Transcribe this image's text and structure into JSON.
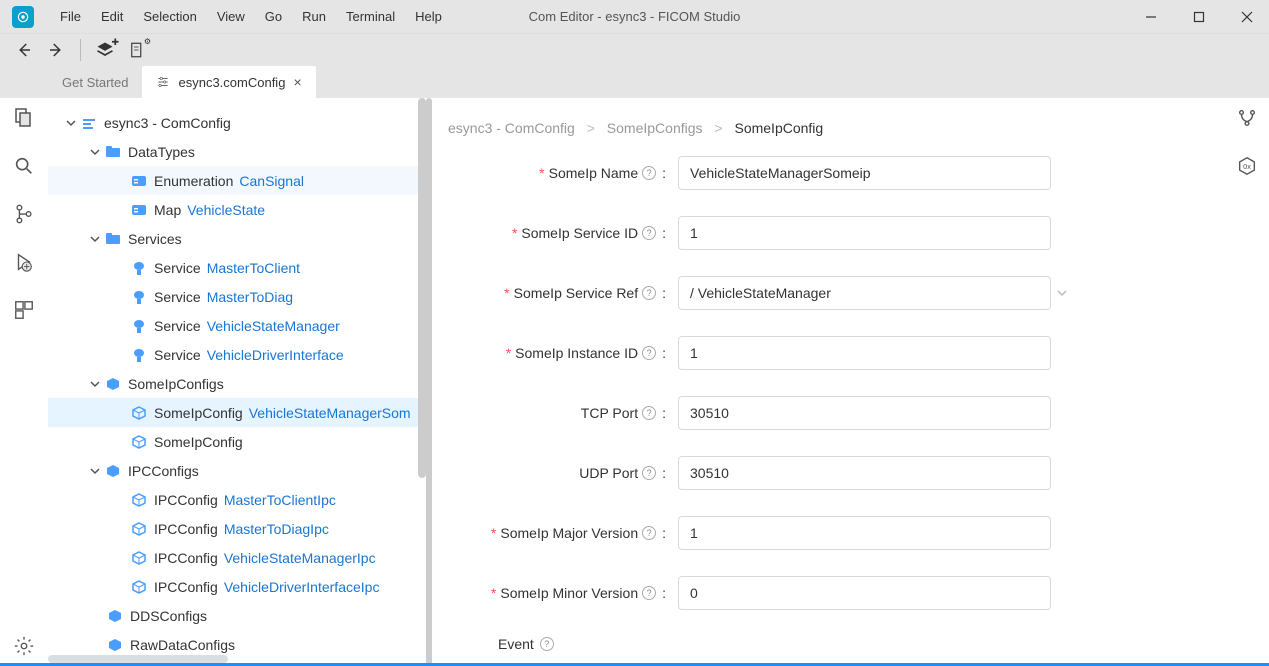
{
  "window": {
    "title": "Com Editor - esync3 - FICOM Studio"
  },
  "menu": [
    "File",
    "Edit",
    "Selection",
    "View",
    "Go",
    "Run",
    "Terminal",
    "Help"
  ],
  "tabs": [
    {
      "label": "Get Started",
      "active": false
    },
    {
      "label": "esync3.comConfig",
      "active": true
    }
  ],
  "tree": {
    "root": {
      "label": "esync3 - ComConfig"
    },
    "dataTypes": {
      "label": "DataTypes",
      "items": [
        {
          "type": "Enumeration",
          "name": "CanSignal"
        },
        {
          "type": "Map",
          "name": "VehicleState"
        }
      ]
    },
    "services": {
      "label": "Services",
      "items": [
        {
          "type": "Service",
          "name": "MasterToClient"
        },
        {
          "type": "Service",
          "name": "MasterToDiag"
        },
        {
          "type": "Service",
          "name": "VehicleStateManager"
        },
        {
          "type": "Service",
          "name": "VehicleDriverInterface"
        }
      ]
    },
    "someIpConfigs": {
      "label": "SomeIpConfigs",
      "items": [
        {
          "type": "SomeIpConfig",
          "name": "VehicleStateManagerSom",
          "selected": true
        },
        {
          "type": "SomeIpConfig",
          "name": ""
        }
      ]
    },
    "ipcConfigs": {
      "label": "IPCConfigs",
      "items": [
        {
          "type": "IPCConfig",
          "name": "MasterToClientIpc"
        },
        {
          "type": "IPCConfig",
          "name": "MasterToDiagIpc"
        },
        {
          "type": "IPCConfig",
          "name": "VehicleStateManagerIpc"
        },
        {
          "type": "IPCConfig",
          "name": "VehicleDriverInterfaceIpc"
        }
      ]
    },
    "ddsConfigs": {
      "label": "DDSConfigs"
    },
    "rawDataConfigs": {
      "label": "RawDataConfigs"
    }
  },
  "breadcrumb": {
    "items": [
      "esync3 - ComConfig",
      "SomeIpConfigs"
    ],
    "current": "SomeIpConfig"
  },
  "form": {
    "someIpName": {
      "label": "SomeIp Name",
      "value": "VehicleStateManagerSomeip",
      "required": true
    },
    "serviceId": {
      "label": "SomeIp Service ID",
      "value": "1",
      "required": true
    },
    "serviceRef": {
      "label": "SomeIp Service Ref",
      "value": "/ VehicleStateManager",
      "required": true
    },
    "instanceId": {
      "label": "SomeIp Instance ID",
      "value": "1",
      "required": true
    },
    "tcpPort": {
      "label": "TCP Port",
      "value": "30510",
      "required": false
    },
    "udpPort": {
      "label": "UDP Port",
      "value": "30510",
      "required": false
    },
    "majorVersion": {
      "label": "SomeIp Major Version",
      "value": "1",
      "required": true
    },
    "minorVersion": {
      "label": "SomeIp Minor Version",
      "value": "0",
      "required": true
    }
  },
  "section": {
    "event": "Event"
  }
}
